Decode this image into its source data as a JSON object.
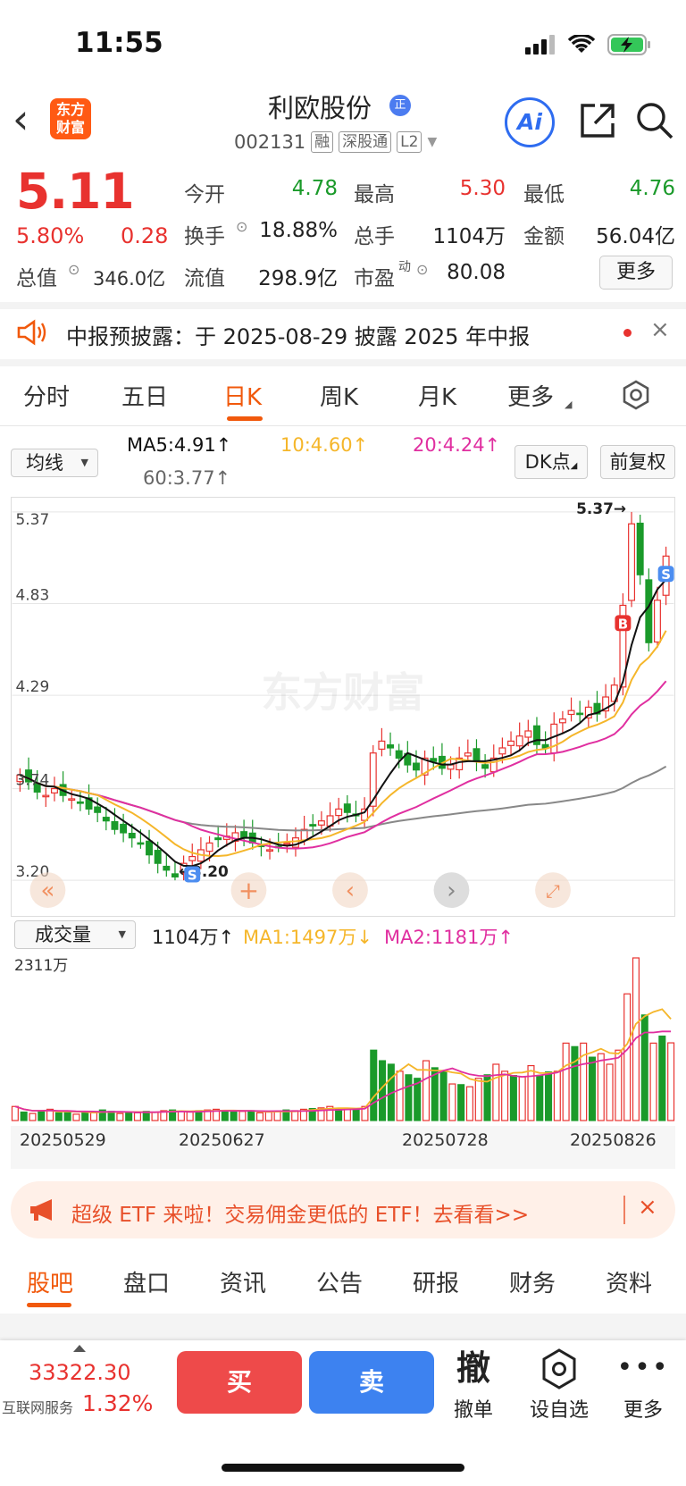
{
  "status": {
    "time": "11:55"
  },
  "header": {
    "app_logo": "东方\n财富",
    "stock_name": "利欧股份",
    "zheng_badge": "正",
    "stock_code": "002131",
    "tags": [
      "融",
      "深股通",
      "L2"
    ],
    "ai_label": "Ai"
  },
  "quote": {
    "price": "5.11",
    "change_pct": "5.80%",
    "change": "0.28",
    "market_value_label": "总值",
    "market_value": "346.0亿",
    "open_label": "今开",
    "open": "4.78",
    "high_label": "最高",
    "high": "5.30",
    "low_label": "最低",
    "low": "4.76",
    "turnover_label": "换手",
    "turnover": "18.88%",
    "volume_label": "总手",
    "volume": "1104万",
    "amount_label": "金额",
    "amount": "56.04亿",
    "float_label": "流值",
    "float_value": "298.9亿",
    "pe_label": "市盈",
    "pe_sup": "动",
    "pe": "80.08",
    "more_label": "更多"
  },
  "notice": {
    "text": "中报预披露：于 2025-08-29 披露 2025 年中报",
    "close": "×"
  },
  "ktabs": [
    "分时",
    "五日",
    "日K",
    "周K",
    "月K",
    "更多"
  ],
  "ma": {
    "select": "均线",
    "ma5": "MA5:4.91↑",
    "ma10": "10:4.60↑",
    "ma20": "20:4.24↑",
    "ma60": "60:3.77↑",
    "dk_button": "DK点",
    "fq_button": "前复权"
  },
  "chart_data": [
    {
      "type": "candlestick",
      "yticks": [
        "5.37",
        "4.83",
        "4.29",
        "3.74",
        "3.20"
      ],
      "ylim": [
        3.2,
        5.37
      ],
      "max_marker": "5.37→",
      "min_marker": "←3.20",
      "watermark": "东方财富",
      "ma_series": [
        {
          "name": "MA5",
          "color": "#111111"
        },
        {
          "name": "MA10",
          "color": "#f5b62a"
        },
        {
          "name": "MA20",
          "color": "#e02fa0"
        },
        {
          "name": "MA60",
          "color": "#888888"
        }
      ],
      "closes": [
        3.82,
        3.78,
        3.72,
        3.7,
        3.74,
        3.7,
        3.68,
        3.66,
        3.62,
        3.6,
        3.55,
        3.5,
        3.48,
        3.45,
        3.42,
        3.35,
        3.3,
        3.26,
        3.22,
        3.3,
        3.34,
        3.38,
        3.42,
        3.44,
        3.46,
        3.48,
        3.45,
        3.42,
        3.4,
        3.38,
        3.4,
        3.42,
        3.45,
        3.5,
        3.52,
        3.55,
        3.58,
        3.62,
        3.6,
        3.58,
        3.62,
        3.95,
        4.02,
        3.98,
        3.92,
        3.88,
        3.85,
        3.92,
        3.9,
        3.86,
        3.88,
        3.92,
        3.95,
        3.9,
        3.86,
        3.92,
        3.98,
        4.02,
        4.05,
        4.08,
        4.0,
        3.98,
        4.12,
        4.15,
        4.2,
        4.18,
        4.22,
        4.18,
        4.28,
        4.35,
        4.82,
        5.3,
        5.0,
        4.6,
        4.85,
        5.11
      ],
      "buy_sell_marks": [
        "B",
        "S",
        "S"
      ]
    },
    {
      "type": "bar",
      "title": "成交量",
      "volume": "1104万↑",
      "ma1": "MA1:1497万↓",
      "ma2": "MA2:1181万↑",
      "ymax_label": "2311万",
      "dates": [
        "20250529",
        "20250627",
        "20250728",
        "20250826"
      ],
      "values": [
        200,
        120,
        100,
        140,
        160,
        110,
        130,
        90,
        120,
        110,
        150,
        130,
        100,
        120,
        110,
        130,
        120,
        140,
        150,
        130,
        120,
        140,
        150,
        160,
        140,
        120,
        130,
        140,
        110,
        120,
        130,
        150,
        140,
        160,
        170,
        180,
        200,
        170,
        160,
        150,
        200,
        1000,
        850,
        800,
        700,
        650,
        600,
        850,
        750,
        700,
        520,
        510,
        480,
        600,
        650,
        800,
        700,
        640,
        620,
        780,
        640,
        690,
        700,
        1100,
        1050,
        1100,
        900,
        950,
        800,
        1000,
        1800,
        2311,
        1500,
        1100,
        1200,
        1104
      ],
      "colors": [
        "r",
        "g",
        "r",
        "g",
        "r",
        "g",
        "g",
        "r",
        "g",
        "r",
        "g",
        "g",
        "r",
        "g",
        "r",
        "g",
        "r",
        "r",
        "g",
        "r",
        "r",
        "g",
        "r",
        "r",
        "g",
        "g",
        "r",
        "g",
        "r",
        "r",
        "r",
        "g",
        "r",
        "r",
        "g",
        "r",
        "r",
        "g",
        "r",
        "g",
        "r",
        "g",
        "g",
        "g",
        "r",
        "g",
        "g",
        "r",
        "g",
        "g",
        "r",
        "g",
        "r",
        "r",
        "g",
        "r",
        "r",
        "g",
        "r",
        "r",
        "g",
        "g",
        "r",
        "r",
        "g",
        "r",
        "g",
        "r",
        "r",
        "r",
        "r",
        "r",
        "g",
        "r",
        "g",
        "r"
      ]
    }
  ],
  "banner": {
    "text": "超级 ETF 来啦！交易佣金更低的 ETF！去看看>>",
    "close": "×"
  },
  "bottom_tabs": [
    "股吧",
    "盘口",
    "资讯",
    "公告",
    "研报",
    "财务",
    "资料"
  ],
  "bottom_bar": {
    "index_value": "33322.30",
    "index_label": "互联网服务",
    "index_pct": "1.32%",
    "buy": "买",
    "sell": "卖",
    "cancel_icon": "撤",
    "cancel_label": "撤单",
    "watch_label": "设自选",
    "more_label": "更多"
  },
  "colors": {
    "up": "#e8322f",
    "down": "#1a9a2a",
    "accent": "#f1590c"
  }
}
